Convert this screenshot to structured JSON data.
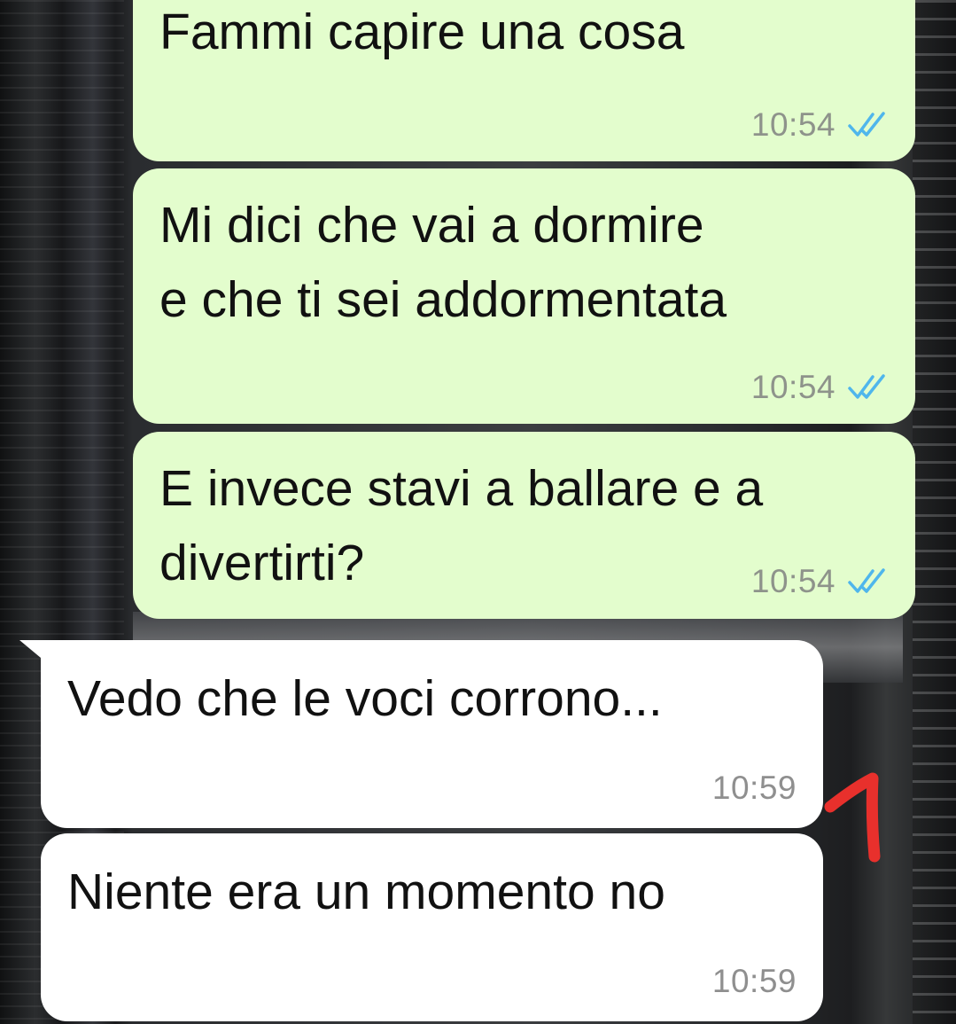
{
  "messages": [
    {
      "direction": "outgoing",
      "text": "Fammi capire una cosa",
      "time": "10:54",
      "status_icon": "double-check-read-icon"
    },
    {
      "direction": "outgoing",
      "text": "Mi dici che vai a dormire\ne che ti sei addormentata",
      "time": "10:54",
      "status_icon": "double-check-read-icon"
    },
    {
      "direction": "outgoing",
      "text": "E invece stavi a ballare e a\ndivertirti?",
      "time": "10:54",
      "status_icon": "double-check-read-icon"
    },
    {
      "direction": "incoming",
      "text": "Vedo che le voci corrono...",
      "time": "10:59"
    },
    {
      "direction": "incoming",
      "text": "Niente era un momento no",
      "time": "10:59"
    }
  ],
  "colors": {
    "outgoing_bubble": "#e3fdcd",
    "incoming_bubble": "#ffffff",
    "read_ticks": "#4fb6ec",
    "annotation_red": "#e8302c"
  },
  "annotation": {
    "icon": "red-arrow-annotation"
  }
}
